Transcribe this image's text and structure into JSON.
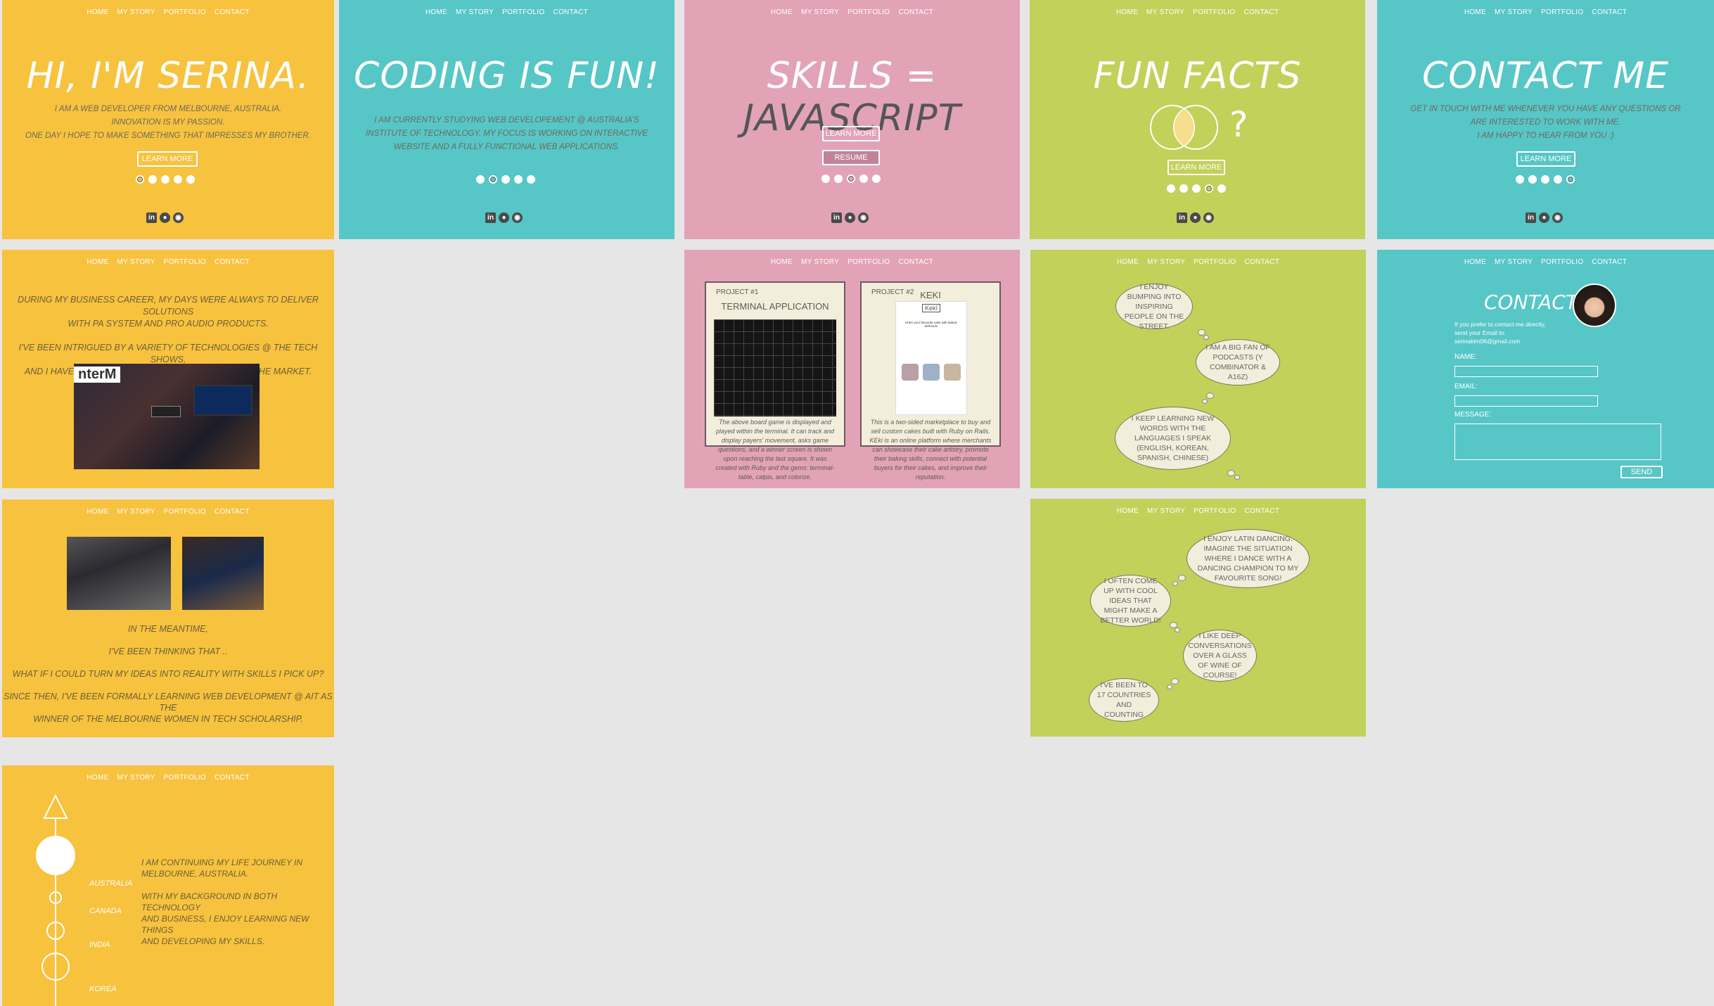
{
  "nav": [
    "HOME",
    "MY STORY",
    "PORTFOLIO",
    "CONTACT"
  ],
  "hero1": {
    "title": "HI, I'M SERINA.",
    "lines": [
      "I AM A WEB DEVELOPER FROM MELBOURNE, AUSTRALIA.",
      "INNOVATION IS MY PASSION.",
      "ONE DAY I HOPE TO MAKE SOMETHING THAT IMPRESSES MY BROTHER."
    ],
    "button": "LEARN MORE"
  },
  "hero2": {
    "title": "CODING IS FUN!",
    "lines": [
      "I AM CURRENTLY STUDYING WEB DEVELOPEMENT @ AUSTRALIA'S",
      "INSTITUTE OF TECHNOLOGY. MY FOCUS IS WORKING ON INTERACTIVE",
      "WEBSITE AND A FULLY FUNCTIONAL WEB APPLICATIONS."
    ]
  },
  "hero3": {
    "title_prefix": "SKILLS = ",
    "title_highlight": "JAVASCRIPT",
    "button": "LEARN MORE",
    "button2": "RESUME"
  },
  "hero4": {
    "title": "FUN FACTS",
    "question": "?",
    "button": "LEARN MORE"
  },
  "hero5": {
    "title": "CONTACT ME",
    "lines": [
      "GET IN TOUCH WITH ME WHENEVER YOU HAVE ANY QUESTIONS OR",
      "ARE INTERESTED TO WORK WITH ME.",
      "I AM HAPPY TO HEAR FROM YOU :)"
    ],
    "button": "LEARN MORE"
  },
  "socials": [
    "in",
    "👤",
    "gh"
  ],
  "story1": {
    "lines": [
      "DURING MY BUSINESS CAREER, MY DAYS WERE ALWAYS TO DELIVER SOLUTIONS",
      "WITH PA SYSTEM AND PRO AUDIO PRODUCTS.",
      "",
      "I'VE BEEN INTRIGUED BY A VARIETY OF TECHNOLOGIES @ THE TECH SHOWS,",
      "AND I HAVE OFTEN COME UP WITH IDEAS WHICH FIT THE MARKET."
    ],
    "photo_text": "nterM"
  },
  "story2": {
    "lines": [
      "IN THE MEANTIME,",
      "",
      "I'VE BEEN THINKING THAT ..",
      "",
      "WHAT IF I COULD TURN MY IDEAS INTO REALITY WITH SKILLS I PICK UP?",
      "",
      "SINCE THEN, I'VE BEEN FORMALLY LEARNING WEB DEVELOPMENT @ AIT AS THE",
      "WINNER OF THE MELBOURNE WOMEN IN TECH SCHOLARSHIP."
    ]
  },
  "story3": {
    "places": [
      "AUSTRALIA",
      "CANADA",
      "INDIA",
      "KOREA"
    ],
    "lines": [
      "I AM CONTINUING MY LIFE JOURNEY IN",
      "MELBOURNE, AUSTRALIA.",
      "",
      "WITH MY BACKGROUND IN BOTH TECHNOLOGY",
      "AND BUSINESS, I  ENJOY LEARNING NEW THINGS",
      "AND DEVELOPING MY SKILLS."
    ]
  },
  "portfolio": {
    "p1": {
      "tag": "PROJECT #1",
      "title": "TERMINAL APPLICATION",
      "desc": "The above board game is displayed and played within the terminal. It can track and display payers' movement, asks game questions, and a winner screen is shown upon reaching the last square. It was created with Ruby and the gems: terminal-table, catpix, and colorize."
    },
    "p2": {
      "tag": "PROJECT #2",
      "title": "KEKI",
      "logo": "Kekî",
      "mock_heading": "Order your favourite cake with baked, delicious!",
      "desc": "This is a two-sided marketplace to buy and sell custom cakes built with Ruby on Rails. KEki is an online platform where merchants can showcase their cake artistry, promote their baking skills, connect with potential buyers for their cakes, and improve their reputation."
    }
  },
  "facts1": [
    "I ENJOY BUMPING INTO INSPIRING PEOPLE ON THE STREET.",
    "I AM A BIG FAN OF PODCASTS (Y COMBINATOR & A16Z)",
    "I KEEP LEARNING NEW WORDS WITH THE LANGUAGES I SPEAK (ENGLISH, KOREAN, SPANISH, CHINESE)"
  ],
  "facts2": [
    "I ENJOY LATIN DANCING. IMAGINE THE SITUATION WHERE I DANCE WITH A DANCING CHAMPION TO MY FAVOURITE SONG!",
    "I OFTEN COME UP WITH COOL IDEAS THAT MIGHT MAKE A BETTER WORLD!",
    "I LIKE DEEP CONVERSATIONS OVER A GLASS OF WINE OF COURSE!",
    "I'VE BEEN TO 17 COUNTRIES AND COUNTING"
  ],
  "contact": {
    "title": "CONTACT",
    "intro": [
      "If you prefer to contact me directly,",
      "send your Email to:",
      "serinakim06@gmail.com"
    ],
    "name_label": "NAME:",
    "email_label": "EMAIL:",
    "message_label": "MESSAGE:",
    "send": "SEND"
  },
  "colors": {
    "yellow": "#f7c23e",
    "teal": "#57c6c7",
    "pink": "#e2a3b7",
    "lime": "#c2d15a",
    "background": "#e6e6e6"
  }
}
